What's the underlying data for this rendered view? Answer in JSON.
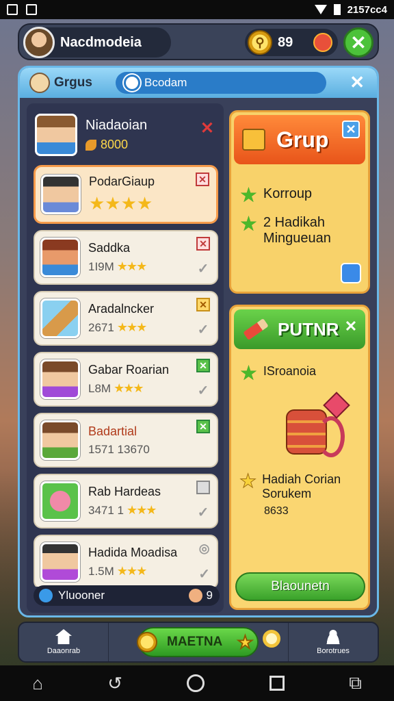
{
  "status": {
    "time": "2157cc4"
  },
  "header": {
    "player_name": "Nacdmodeia",
    "coins": "89"
  },
  "panel": {
    "title": "Grgus",
    "search_value": "Bcodam"
  },
  "me": {
    "name": "Niadaoian",
    "score": "8000"
  },
  "list": [
    {
      "name": "PodarGiaup",
      "sub": "",
      "stars": "★★★★",
      "action": "x",
      "selected": true
    },
    {
      "name": "Saddka",
      "sub": "1I9M",
      "stars": "★★★",
      "action": "x"
    },
    {
      "name": "Aradalncker",
      "sub": "2671",
      "stars": "★★★",
      "action": "y"
    },
    {
      "name": "Gabar Roarian",
      "sub": "L8M",
      "stars": "★★★",
      "action": "ok"
    },
    {
      "name": "Badartial",
      "sub": "1571 13670",
      "stars": "",
      "action": "ok"
    },
    {
      "name": "Rab Hardeas",
      "sub": "3471 1",
      "stars": "★★★",
      "action": "g"
    },
    {
      "name": "Hadida Moadisa",
      "sub": "1.5M",
      "stars": "★★★",
      "action": "o"
    }
  ],
  "left_footer": {
    "label": "Yluooner",
    "count": "9"
  },
  "card1": {
    "title": "Grup",
    "line1": "Korroup",
    "line2": "2 Hadikah Mingueuan"
  },
  "card2": {
    "title": "PUTNR",
    "line1": "ISroanoia",
    "line2": "Hadiah Corian Sorukem",
    "line3": "8633",
    "button": "Blaounetn"
  },
  "bottom_nav": {
    "left": "Daaonrab",
    "center": "MAETNA",
    "right": "Borotrues"
  },
  "colors": {
    "accent_green": "#4cc23a",
    "accent_orange": "#e8541a",
    "panel_border": "#6ab8e8"
  }
}
